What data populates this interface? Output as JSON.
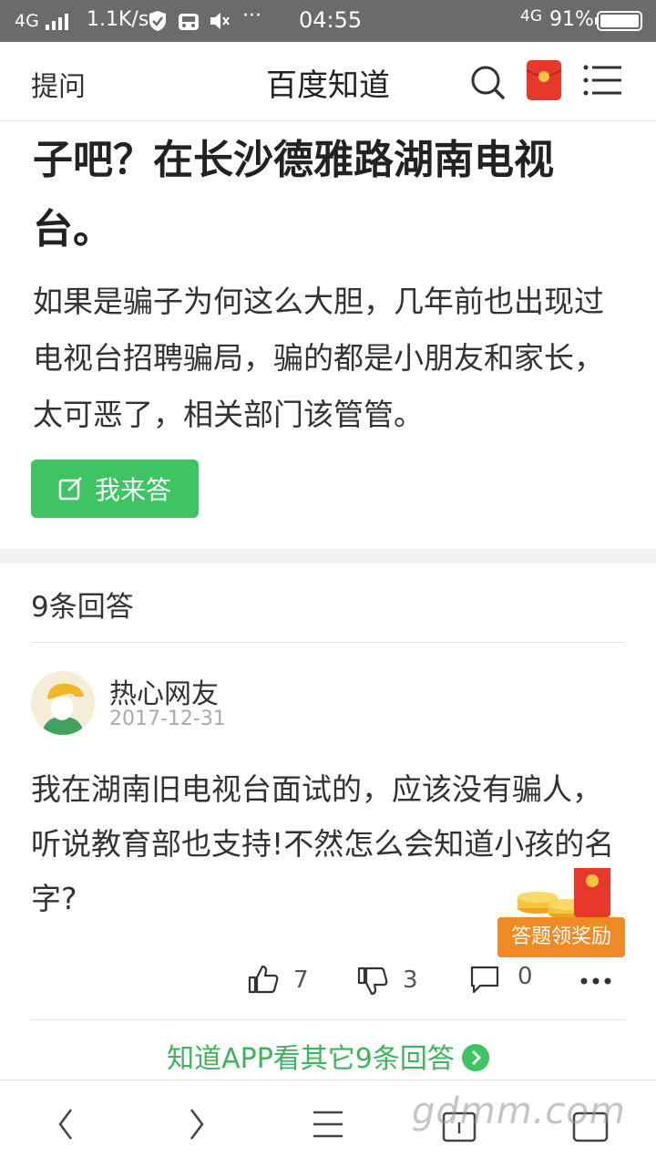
{
  "status": {
    "network": "4G",
    "speed": "1.1K/s",
    "time": "04:55",
    "battery_network": "4G",
    "battery": "91%"
  },
  "nav": {
    "ask": "提问",
    "title": "百度知道"
  },
  "question": {
    "title": "子吧？在长沙德雅路湖南电视台。",
    "description": "如果是骗子为何这么大胆，几年前也出现过电视台招聘骗局，骗的都是小朋友和家长，太可恶了，相关部门该管管。",
    "answer_button": "我来答"
  },
  "answers": {
    "count_label": "9条回答",
    "items": [
      {
        "user": "热心网友",
        "date": "2017-12-31",
        "text": "我在湖南旧电视台面试的，应该没有骗人，听说教育部也支持!不然怎么会知道小孩的名字?",
        "likes": "7",
        "dislikes": "3",
        "comments": "0"
      }
    ],
    "more_link": "知道APP看其它9条回答"
  },
  "promo": {
    "label": "答题领奖励"
  },
  "watermark": "gdmm.com",
  "colors": {
    "accent_green": "#3fc463",
    "promo_orange": "#f08a24",
    "redpacket": "#e8372b"
  }
}
